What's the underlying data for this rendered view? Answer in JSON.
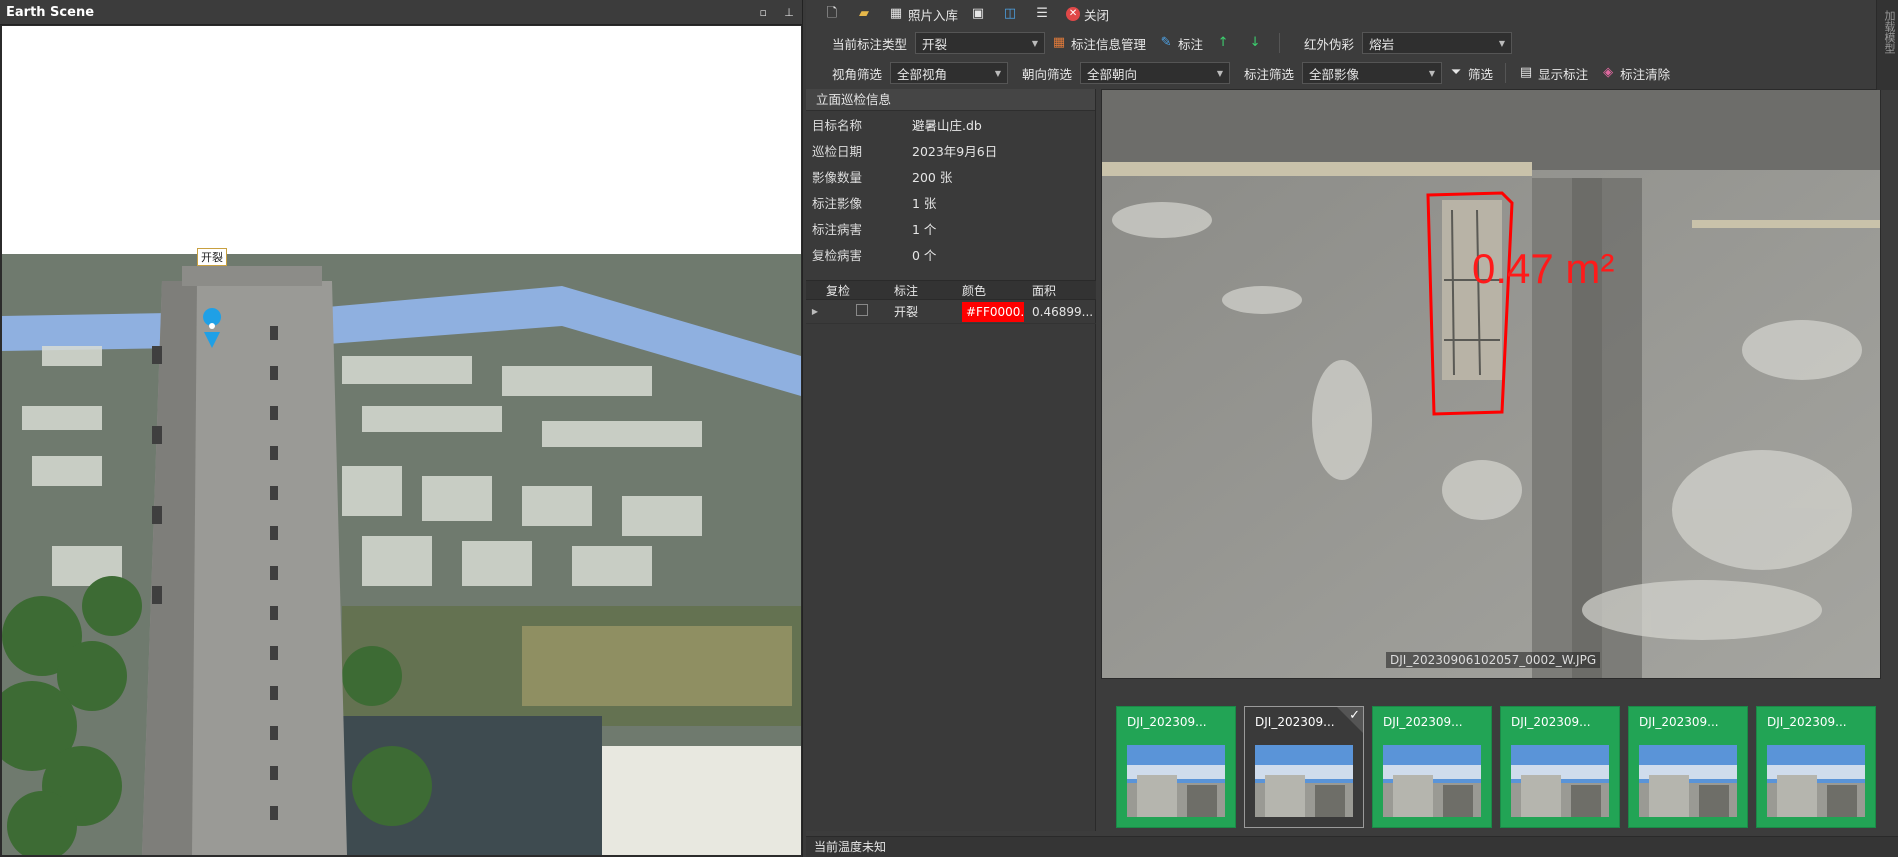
{
  "earth": {
    "title": "Earth Scene",
    "marker_label": "开裂"
  },
  "toolbar1": {
    "photo_import": "照片入库",
    "close": "关闭"
  },
  "toolbar2": {
    "current_type_label": "当前标注类型",
    "current_type_value": "开裂",
    "info_manage": "标注信息管理",
    "annotate": "标注",
    "infrared_label": "红外伪彩",
    "infrared_value": "熔岩"
  },
  "toolbar3": {
    "view_filter_label": "视角筛选",
    "view_filter_value": "全部视角",
    "orient_filter_label": "朝向筛选",
    "orient_filter_value": "全部朝向",
    "annot_filter_label": "标注筛选",
    "annot_filter_value": "全部影像",
    "filter_btn": "筛选",
    "show_annot": "显示标注",
    "clear_annot": "标注清除"
  },
  "info": {
    "header": "立面巡检信息",
    "rows": [
      {
        "k": "目标名称",
        "v": "避暑山庄.db"
      },
      {
        "k": "巡检日期",
        "v": "2023年9月6日"
      },
      {
        "k": "影像数量",
        "v": "200 张"
      },
      {
        "k": "标注影像",
        "v": "1 张"
      },
      {
        "k": "标注病害",
        "v": "1 个"
      },
      {
        "k": "复检病害",
        "v": "0 个"
      }
    ]
  },
  "grid": {
    "headers": [
      "复检",
      "标注",
      "颜色",
      "面积"
    ],
    "rows": [
      {
        "recheck": false,
        "label": "开裂",
        "color": "#FF0000...",
        "area": "0.46899..."
      }
    ]
  },
  "viewer": {
    "area_label": "0.47 m²",
    "filename": "DJI_20230906102057_0002_W.JPG"
  },
  "thumbs": [
    {
      "name": "DJI_202309...",
      "selected": false
    },
    {
      "name": "DJI_202309...",
      "selected": true
    },
    {
      "name": "DJI_202309...",
      "selected": false
    },
    {
      "name": "DJI_202309...",
      "selected": false
    },
    {
      "name": "DJI_202309...",
      "selected": false
    },
    {
      "name": "DJI_202309...",
      "selected": false
    }
  ],
  "status": "当前温度未知",
  "side_tab": "加载模型",
  "colors": {
    "accent_green": "#22a455",
    "annot_red": "#ff0000"
  }
}
